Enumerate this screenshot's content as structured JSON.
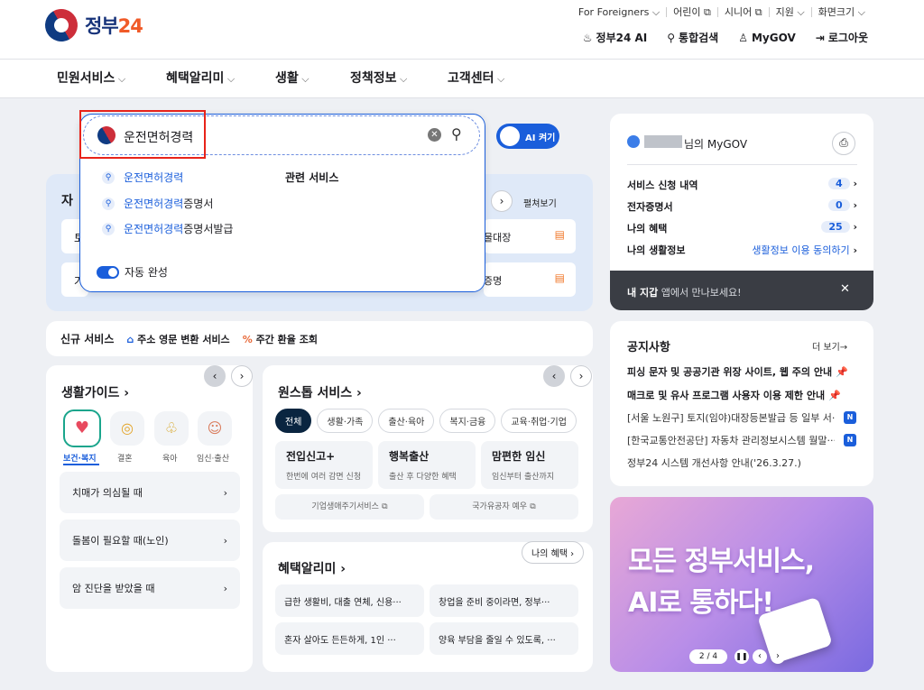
{
  "header": {
    "logo_text": "정부",
    "logo_num": "24",
    "util_links": [
      "For Foreigners ⌵",
      "어린이 ⧉",
      "시니어 ⧉",
      "지원 ⌵",
      "화면크기 ⌵"
    ],
    "ai_label": "정부24 AI",
    "search_label": "통합검색",
    "mygov_label": "MyGOV",
    "logout_label": "로그아웃"
  },
  "nav": [
    "민원서비스",
    "혜택알리미",
    "생활",
    "정책정보",
    "고객센터"
  ],
  "search": {
    "value": "운전면허경력",
    "suggestions": [
      {
        "hl": "운전면허경력",
        "rest": ""
      },
      {
        "hl": "운전면허경력",
        "rest": "증명서"
      },
      {
        "hl": "운전면허경력",
        "rest": "증명서발급"
      }
    ],
    "related_title": "관련 서비스",
    "autocomplete_label": "자동 완성",
    "ai_toggle_label": "AI 켜기"
  },
  "frequent": {
    "title_partial": "자",
    "expand_label": "펼쳐보기",
    "items": [
      "토",
      "가"
    ],
    "right_items": [
      "물대장",
      "증명"
    ]
  },
  "new_services": {
    "title": "신규 서비스",
    "items": [
      "주소 영문 변환 서비스",
      "주간 환율 조회"
    ]
  },
  "life_guide": {
    "title": "생활가이드",
    "categories": [
      "보건·복지",
      "결혼",
      "육아",
      "임신·출산"
    ],
    "rows": [
      "치매가 의심될 때",
      "돌봄이 필요할 때(노인)",
      "암 진단을 받았을 때"
    ]
  },
  "onestop": {
    "title": "원스톱 서비스",
    "filters": [
      "전체",
      "생활·가족",
      "출산·육아",
      "복지·금융",
      "교육·취업·기업"
    ],
    "cards": [
      {
        "t": "전입신고+",
        "d": "한번에 여러 감면 신청"
      },
      {
        "t": "행복출산",
        "d": "출산 후 다양한 혜택"
      },
      {
        "t": "맘편한 임신",
        "d": "임신부터 출산까지"
      }
    ],
    "links": [
      "기업생애주기서비스",
      "국가유공자 예우"
    ]
  },
  "benefit": {
    "title": "혜택알리미",
    "my_label": "나의 혜택",
    "items": [
      "급한 생활비, 대출 연체, 신용···",
      "창업을 준비 중이라면, 정부···",
      "혼자 살아도 든든하게, 1인 ···",
      "양육 부담을 줄일 수 있도록, ···"
    ]
  },
  "mygov": {
    "suffix": "님의 MyGOV",
    "rows": [
      {
        "label": "서비스 신청 내역",
        "value": "4"
      },
      {
        "label": "전자증명서",
        "value": "0"
      },
      {
        "label": "나의 혜택",
        "value": "25"
      },
      {
        "label": "나의 생활정보",
        "value": "생활정보 이용 동의하기"
      }
    ],
    "wallet_bold": "내 지갑",
    "wallet_text": "앱에서 만나보세요!"
  },
  "notice": {
    "title": "공지사항",
    "more": "더 보기→",
    "items": [
      "피싱 문자 및 공공기관 위장 사이트, 웹 주의 안내",
      "매크로 및 유사 프로그램 사용자 이용 제한 안내",
      "[서울 노원구] 토지(임야)대장등본발급 등 일부 서···",
      "[한국교통안전공단] 자동차 관리정보시스템 월말···",
      "정부24 시스템 개선사항 안내('26.3.27.)"
    ]
  },
  "banner": {
    "line1": "모든 정부서비스,",
    "line2": "AI로 통하다!",
    "page": "2 / 4"
  }
}
